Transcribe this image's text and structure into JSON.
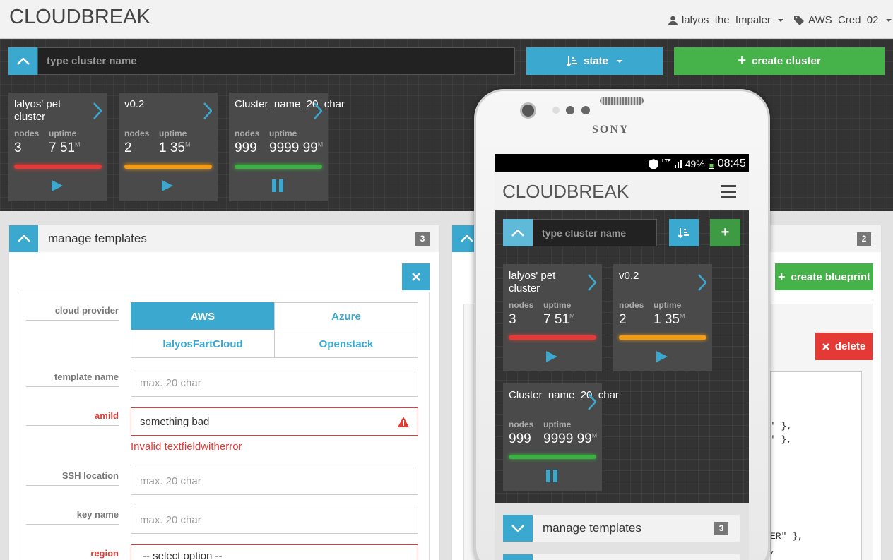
{
  "header": {
    "brand": "CLOUDBREAK",
    "user": "lalyos_the_Impaler",
    "credential": "AWS_Cred_02"
  },
  "toolbar": {
    "search_placeholder": "type cluster name",
    "state_label": "state",
    "create_label": "create cluster"
  },
  "clusters": [
    {
      "name": "lalyos' pet cluster",
      "nodes_label": "nodes",
      "uptime_label": "uptime",
      "nodes": "3",
      "hours": "7",
      "minutes": "51",
      "unit": "M",
      "status_color": "#e53935",
      "action": "play"
    },
    {
      "name": "v0.2",
      "nodes_label": "nodes",
      "uptime_label": "uptime",
      "nodes": "2",
      "hours": "1",
      "minutes": "35",
      "unit": "M",
      "status_color": "#f39c12",
      "action": "play"
    },
    {
      "name": "Cluster_name_20_char",
      "nodes_label": "nodes",
      "uptime_label": "uptime",
      "nodes": "999",
      "hours": "9999",
      "minutes": "99",
      "unit": "M",
      "status_color": "#3cb043",
      "action": "pause"
    }
  ],
  "templates_panel": {
    "title": "manage templates",
    "count": "3",
    "cloud_provider_label": "cloud provider",
    "providers": [
      "AWS",
      "Azure",
      "lalyosFartCloud",
      "Openstack"
    ],
    "template_name_label": "template name",
    "template_name_placeholder": "max. 20 char",
    "amild_label": "amild",
    "amild_value": "something bad",
    "amild_error": "Invalid textfieldwitherror",
    "ssh_label": "SSH location",
    "ssh_placeholder": "max. 20 char",
    "key_label": "key name",
    "key_placeholder": "max. 20 char",
    "region_label": "region",
    "region_value": "-- select option --"
  },
  "blueprints_panel": {
    "count": "2",
    "create_label": "create blueprint",
    "delete_label": "delete",
    "code_lines": [
      "' },",
      "' },",
      "ER\" },",
      ","
    ]
  },
  "phone": {
    "maker": "SONY",
    "status": {
      "battery": "49%",
      "time": "08:45",
      "network": "LTE"
    },
    "brand": "CLOUDBREAK",
    "search_placeholder": "type cluster name",
    "clusters": [
      {
        "name": "lalyos' pet cluster",
        "nodes": "3",
        "hours": "7",
        "minutes": "51"
      },
      {
        "name": "v0.2",
        "nodes": "2",
        "hours": "1",
        "minutes": "35"
      },
      {
        "name": "Cluster_name_20_char",
        "nodes": "999",
        "hours": "9999",
        "minutes": "99"
      }
    ],
    "nodes_label": "nodes",
    "uptime_label": "uptime",
    "unit": "M",
    "templates_title": "manage templates",
    "templates_count": "3"
  }
}
